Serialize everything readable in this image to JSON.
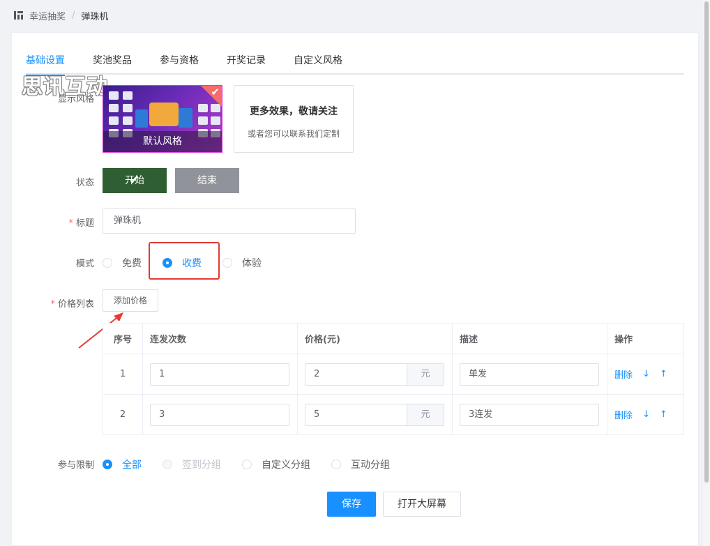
{
  "breadcrumb": {
    "root": "幸运抽奖",
    "separator": "/",
    "current": "弹珠机"
  },
  "tabs": [
    "基础设置",
    "奖池奖品",
    "参与资格",
    "开奖记录",
    "自定义风格"
  ],
  "watermark": "思讯互动",
  "display_style": {
    "label": "显示风格",
    "selected_caption": "默认风格",
    "more_title": "更多效果，敬请关注",
    "more_subtitle": "或者您可以联系我们定制"
  },
  "status": {
    "label": "状态",
    "on_label": "开始",
    "off_label": "结束"
  },
  "title_field": {
    "required": "*",
    "label": "标题",
    "value": "弹珠机"
  },
  "mode": {
    "label": "模式",
    "options": [
      "免费",
      "收费",
      "体验"
    ],
    "selected": "收费"
  },
  "price_list": {
    "required": "*",
    "label": "价格列表",
    "add_button": "添加价格",
    "columns": [
      "序号",
      "连发次数",
      "价格(元)",
      "描述",
      "操作"
    ],
    "unit": "元",
    "rows": [
      {
        "index": "1",
        "count": "1",
        "price": "2",
        "desc": "单发",
        "delete": "删除"
      },
      {
        "index": "2",
        "count": "3",
        "price": "5",
        "desc": "3连发",
        "delete": "删除"
      }
    ]
  },
  "participation": {
    "label": "参与限制",
    "options": [
      "全部",
      "签到分组",
      "自定义分组",
      "互动分组"
    ],
    "selected": "全部"
  },
  "actions": {
    "save": "保存",
    "big_screen": "打开大屏幕"
  },
  "colors": {
    "primary": "#1890ff",
    "status_on": "#2e5e32",
    "status_off": "#909399",
    "highlight": "#e53935"
  }
}
